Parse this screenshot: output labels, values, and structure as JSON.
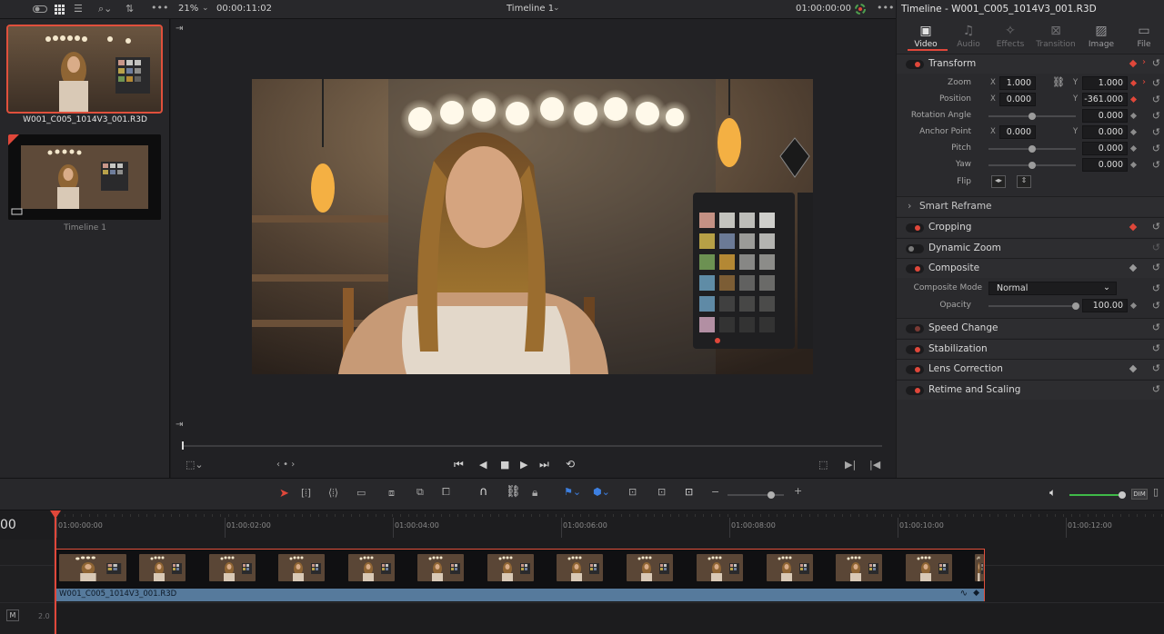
{
  "topbar": {
    "zoom": "21%",
    "timecode_left": "00:00:11:02",
    "timeline_name": "Timeline 1",
    "timecode_right": "01:00:00:00"
  },
  "media_pool": {
    "clips": [
      {
        "name": "W001_C005_1014V3_001.R3D"
      },
      {
        "name": "Timeline 1"
      }
    ]
  },
  "inspector": {
    "title": "Timeline - W001_C005_1014V3_001.R3D",
    "tabs": [
      "Video",
      "Audio",
      "Effects",
      "Transition",
      "Image",
      "File"
    ],
    "active_tab": "Video",
    "transform": {
      "label": "Transform",
      "zoom_label": "Zoom",
      "zoom_x": "1.000",
      "zoom_y": "1.000",
      "position_label": "Position",
      "position_x": "0.000",
      "position_y": "-361.000",
      "rotation_label": "Rotation Angle",
      "rotation": "0.000",
      "anchor_label": "Anchor Point",
      "anchor_x": "0.000",
      "anchor_y": "0.000",
      "pitch_label": "Pitch",
      "pitch": "0.000",
      "yaw_label": "Yaw",
      "yaw": "0.000",
      "flip_label": "Flip",
      "x": "X",
      "y": "Y"
    },
    "smart_reframe": "Smart Reframe",
    "cropping": "Cropping",
    "dynamic_zoom": "Dynamic Zoom",
    "composite": {
      "label": "Composite",
      "mode_label": "Composite Mode",
      "mode_value": "Normal",
      "opacity_label": "Opacity",
      "opacity_value": "100.00"
    },
    "speed_change": "Speed Change",
    "stabilization": "Stabilization",
    "lens_correction": "Lens Correction",
    "retime_scaling": "Retime and Scaling"
  },
  "timeline": {
    "timecode_partial": "00",
    "ticks": [
      "01:00:00:00",
      "01:00:02:00",
      "01:00:04:00",
      "01:00:06:00",
      "01:00:08:00",
      "01:00:10:00",
      "01:00:12:00"
    ],
    "clip_name": "W001_C005_1014V3_001.R3D",
    "track_audio_label": "M",
    "track_audio_ch": "2.0"
  },
  "audio": {
    "dim_label": "DIM"
  },
  "colors": {
    "accent": "#e0473a",
    "clip_bar": "#567a9c",
    "level": "#3fb948"
  }
}
